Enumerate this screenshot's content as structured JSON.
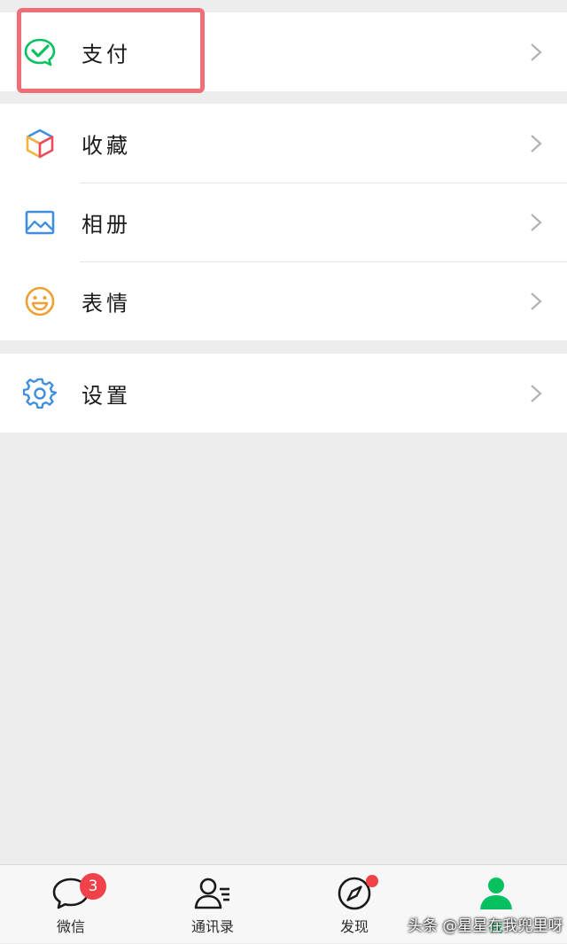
{
  "menu": {
    "pay": {
      "label": "支付",
      "icon": "wechat-pay-icon"
    },
    "favorites": {
      "label": "收藏",
      "icon": "cube-icon"
    },
    "album": {
      "label": "相册",
      "icon": "image-icon"
    },
    "stickers": {
      "label": "表情",
      "icon": "smiley-icon"
    },
    "settings": {
      "label": "设置",
      "icon": "gear-icon"
    }
  },
  "tabbar": {
    "chats": {
      "label": "微信",
      "badge": "3",
      "icon": "chat-bubble-icon"
    },
    "contacts": {
      "label": "通讯录",
      "icon": "contacts-icon"
    },
    "discover": {
      "label": "发现",
      "icon": "compass-icon"
    },
    "me": {
      "label": "我",
      "icon": "person-icon",
      "active": true
    }
  },
  "watermark": "头条 @星星在我兜里呀",
  "colors": {
    "accent_green": "#07c160",
    "badge_red": "#f1424a",
    "highlight": "#ee6f76",
    "background": "#ededed"
  }
}
